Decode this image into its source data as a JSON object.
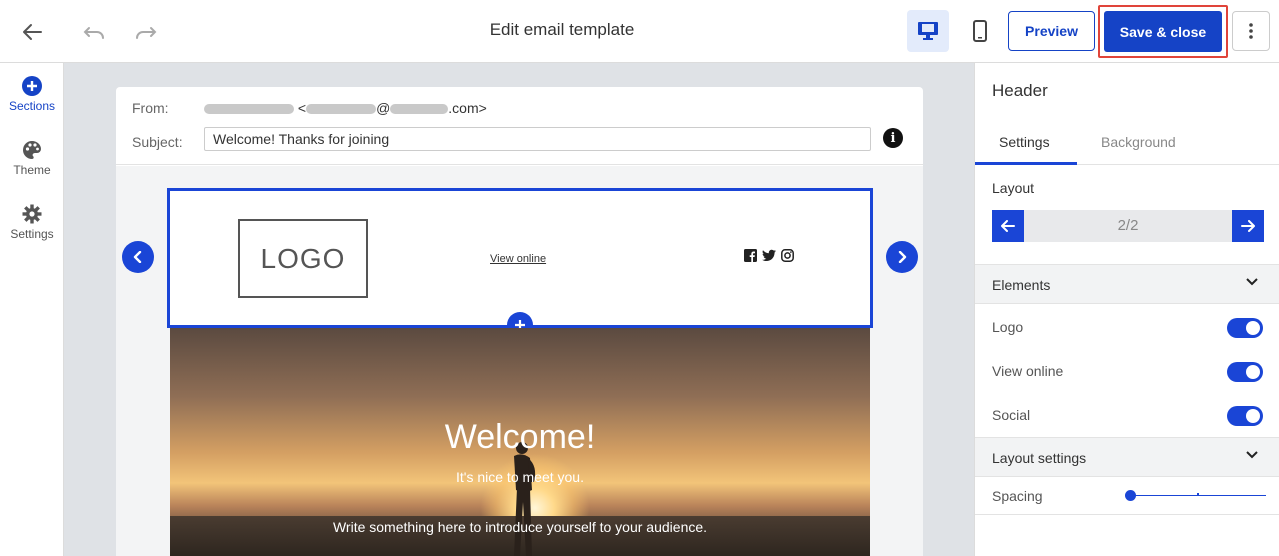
{
  "toolbar": {
    "title": "Edit email template",
    "preview_label": "Preview",
    "save_label": "Save & close"
  },
  "rail": {
    "items": [
      {
        "label": "Sections",
        "icon": "plus-circle-icon",
        "active": true
      },
      {
        "label": "Theme",
        "icon": "palette-icon"
      },
      {
        "label": "Settings",
        "icon": "gear-icon"
      }
    ]
  },
  "email": {
    "from_label": "From:",
    "from_suffix": "@",
    "from_domain": ".com>",
    "from_open": "<",
    "subject_label": "Subject:",
    "subject_value": "Welcome! Thanks for joining",
    "header": {
      "logo_text": "LOGO",
      "view_online": "View online"
    },
    "hero": {
      "title": "Welcome!",
      "subtitle": "It's nice to meet you.",
      "text": "Write something here to introduce yourself to your audience."
    }
  },
  "panel": {
    "title": "Header",
    "tabs": [
      "Settings",
      "Background"
    ],
    "layout_label": "Layout",
    "layout_value": "2/2",
    "elements_label": "Elements",
    "elements": [
      {
        "label": "Logo",
        "on": true
      },
      {
        "label": "View online",
        "on": true
      },
      {
        "label": "Social",
        "on": true
      }
    ],
    "layout_settings_label": "Layout settings",
    "spacing_label": "Spacing"
  },
  "colors": {
    "accent": "#1a45d6",
    "save_highlight": "#e0443a"
  }
}
